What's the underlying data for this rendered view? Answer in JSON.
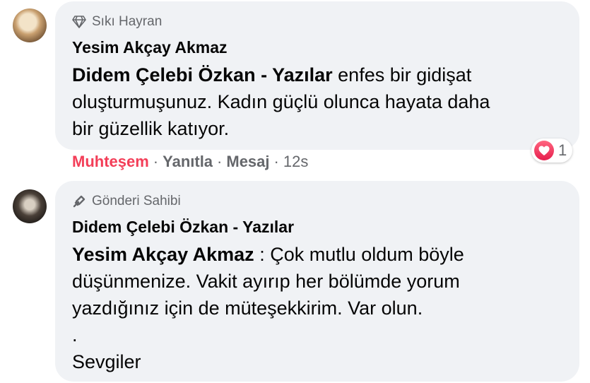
{
  "comments": [
    {
      "badge": "Sıkı Hayran",
      "badge_icon": "diamond-icon",
      "author": "Yesim Akçay Akmaz",
      "mention": "Didem Çelebi Özkan - Yazılar",
      "text_lines": [
        "enfes bir gidişat",
        "oluşturmuşunuz. Kadın güçlü olunca hayata daha",
        "bir güzellik katıyor."
      ],
      "actions": {
        "reaction": "Muhteşem",
        "reply": "Yanıtla",
        "message": "Mesaj",
        "time": "12s",
        "separator": "·"
      },
      "reaction_count": "1",
      "reaction_icon": "love-heart-icon",
      "reaction_color": "#f33e58"
    },
    {
      "badge": "Gönderi Sahibi",
      "badge_icon": "megaphone-icon",
      "author": "Didem Çelebi Özkan - Yazılar",
      "mention": "Yesim Akçay Akmaz",
      "text_lines": [
        ": Çok mutlu oldum böyle",
        "düşünmenize. Vakit ayırıp her bölümde yorum",
        "yazdığınız için de müteşekkirim. Var olun.",
        ".",
        "Sevgiler"
      ]
    }
  ],
  "colors": {
    "bubble_bg": "#f0f2f5",
    "secondary_text": "#65676b"
  }
}
